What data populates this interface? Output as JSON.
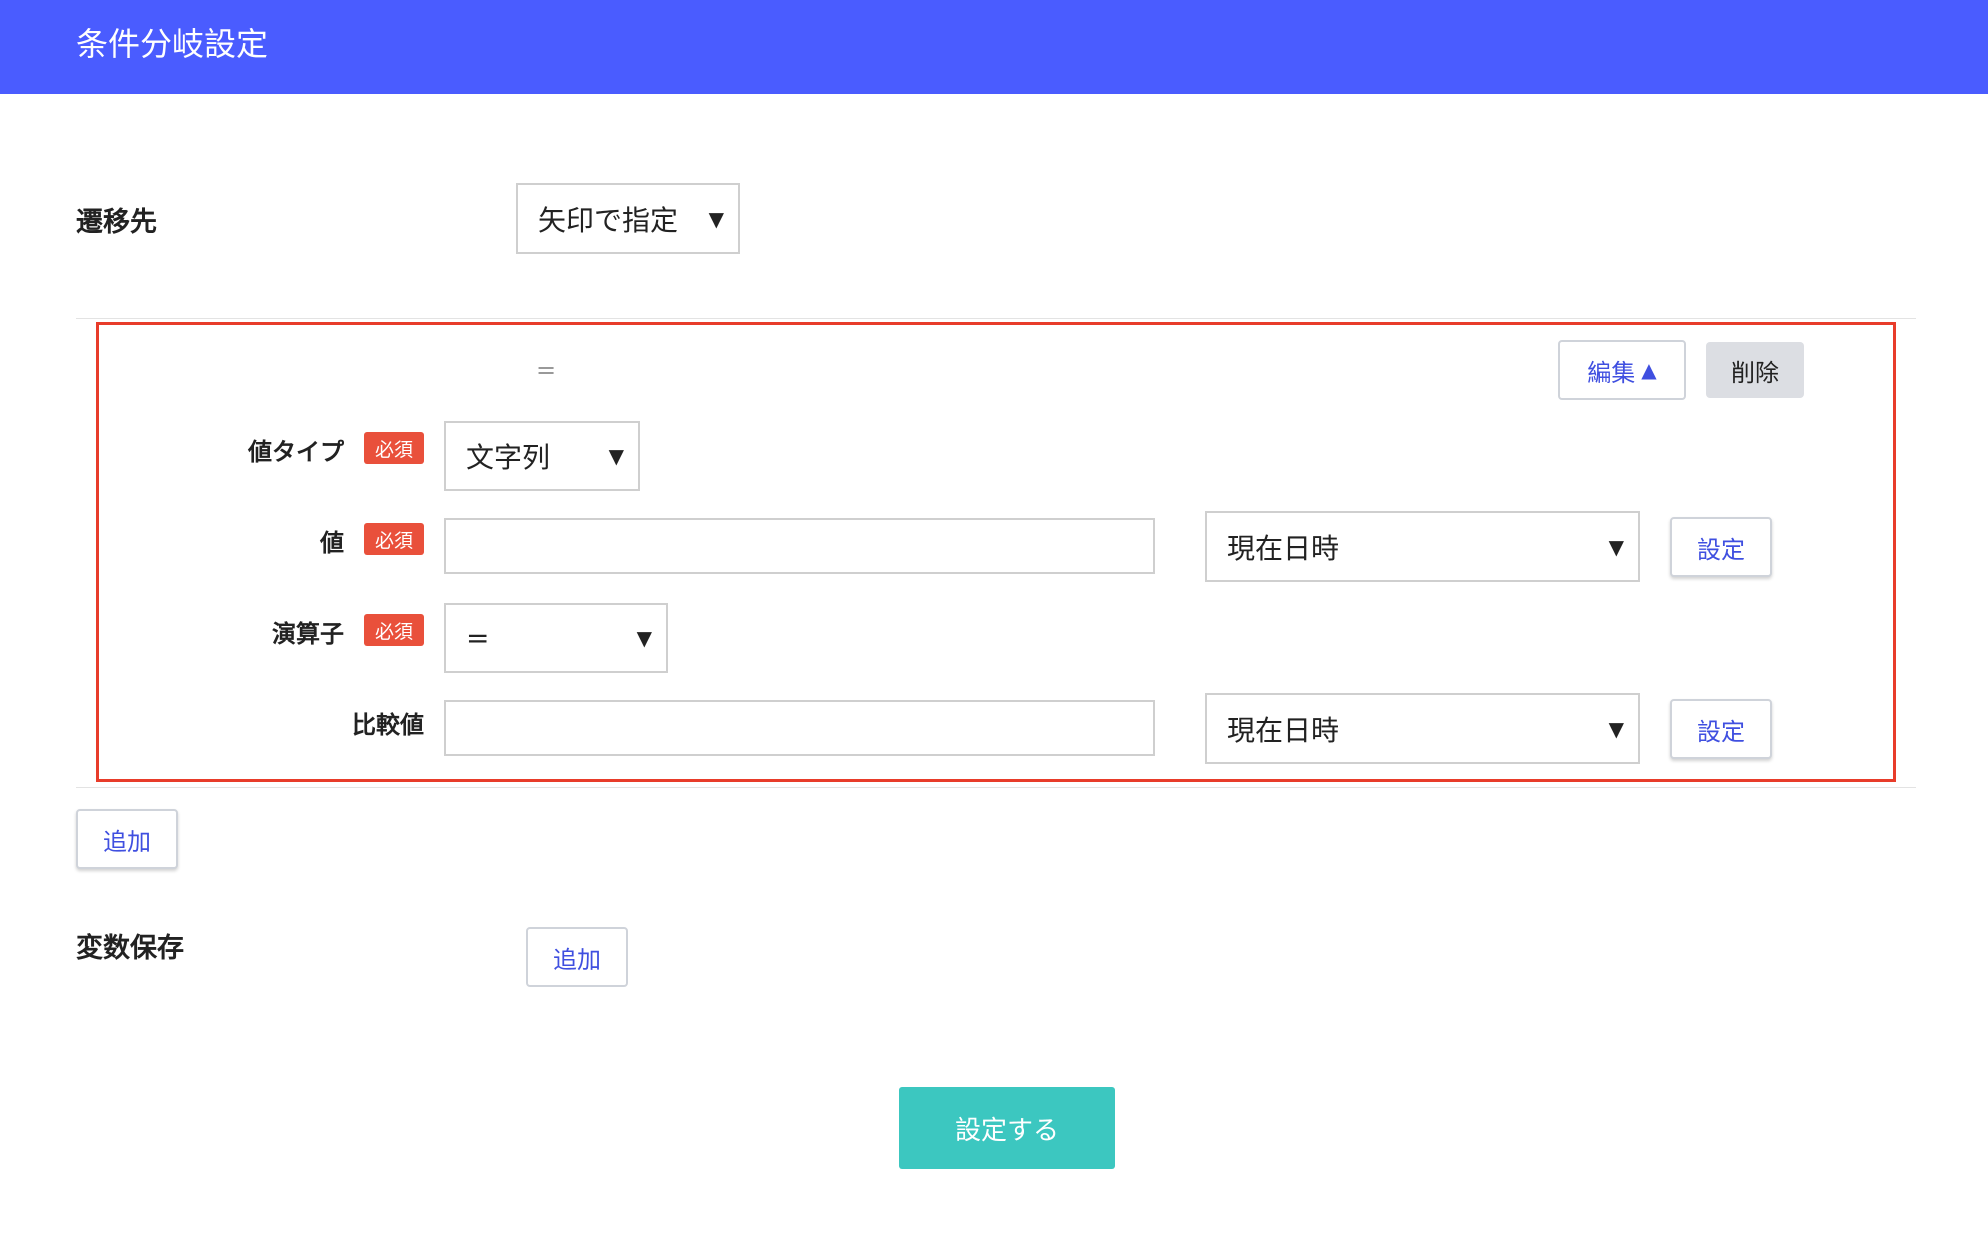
{
  "header": {
    "title": "条件分岐設定"
  },
  "destination": {
    "label": "遷移先",
    "select_value": "矢印で指定"
  },
  "condition": {
    "operator_summary": "=",
    "edit_label": "編集",
    "delete_label": "削除",
    "required_badge": "必須",
    "value_type": {
      "label": "値タイプ",
      "value": "文字列"
    },
    "value": {
      "label": "値",
      "input_value": "",
      "preset_value": "現在日時",
      "set_label": "設定"
    },
    "operator": {
      "label": "演算子",
      "value": "="
    },
    "compare_value": {
      "label": "比較値",
      "input_value": "",
      "preset_value": "現在日時",
      "set_label": "設定"
    }
  },
  "add_condition_label": "追加",
  "variable_save": {
    "label": "変数保存",
    "add_label": "追加"
  },
  "submit_label": "設定する",
  "icons": {
    "dropdown": "caret-down-icon",
    "edit_toggle": "triangle-up-icon"
  },
  "colors": {
    "header": "#4a5cff",
    "required_badge": "#e9503b",
    "condition_border": "#e83c2a",
    "submit": "#3cc7c0",
    "link_text": "#3f4fe0"
  }
}
